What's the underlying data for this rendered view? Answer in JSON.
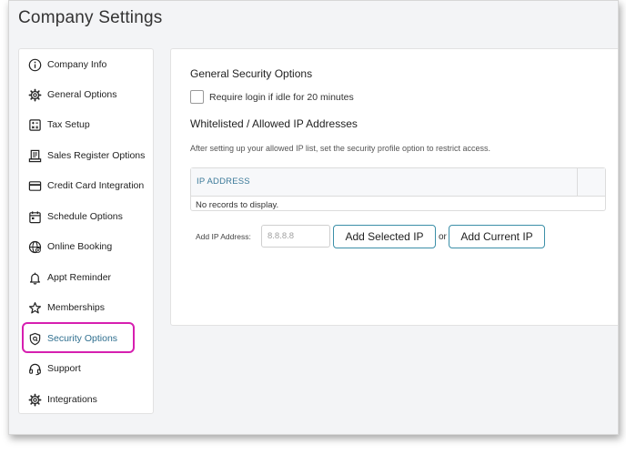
{
  "header": {
    "title": "Company Settings"
  },
  "sidebar": {
    "items": [
      {
        "label": "Company Info",
        "icon": "info-icon"
      },
      {
        "label": "General Options",
        "icon": "gear-icon"
      },
      {
        "label": "Tax Setup",
        "icon": "calculator-icon"
      },
      {
        "label": "Sales Register Options",
        "icon": "receipt-icon"
      },
      {
        "label": "Credit Card Integration",
        "icon": "credit-card-icon"
      },
      {
        "label": "Schedule Options",
        "icon": "calendar-icon"
      },
      {
        "label": "Online Booking",
        "icon": "globe-icon"
      },
      {
        "label": "Appt Reminder",
        "icon": "bell-icon"
      },
      {
        "label": "Memberships",
        "icon": "star-icon"
      },
      {
        "label": "Security Options",
        "icon": "shield-icon",
        "active": true
      },
      {
        "label": "Support",
        "icon": "headset-icon"
      },
      {
        "label": "Integrations",
        "icon": "gear-icon"
      }
    ],
    "highlight_color": "#d61fb0"
  },
  "main": {
    "general_title": "General Security Options",
    "idle_checkbox": {
      "label": "Require login if idle for 20 minutes",
      "checked": false
    },
    "whitelist_title": "Whitelisted / Allowed IP Addresses",
    "help_text": "After setting up your allowed IP list, set the security profile option to restrict access.",
    "table": {
      "columns": [
        "IP ADDRESS"
      ],
      "empty_message": "No records to display."
    },
    "add_ip": {
      "label": "Add IP Address:",
      "placeholder": "8.8.8.8",
      "value": "",
      "add_selected_label": "Add Selected IP",
      "or_text": "or",
      "add_current_label": "Add Current IP"
    }
  },
  "colors": {
    "accent": "#3b8fa8",
    "active_text": "#2f6f8f",
    "header_text": "#3c7a99"
  }
}
